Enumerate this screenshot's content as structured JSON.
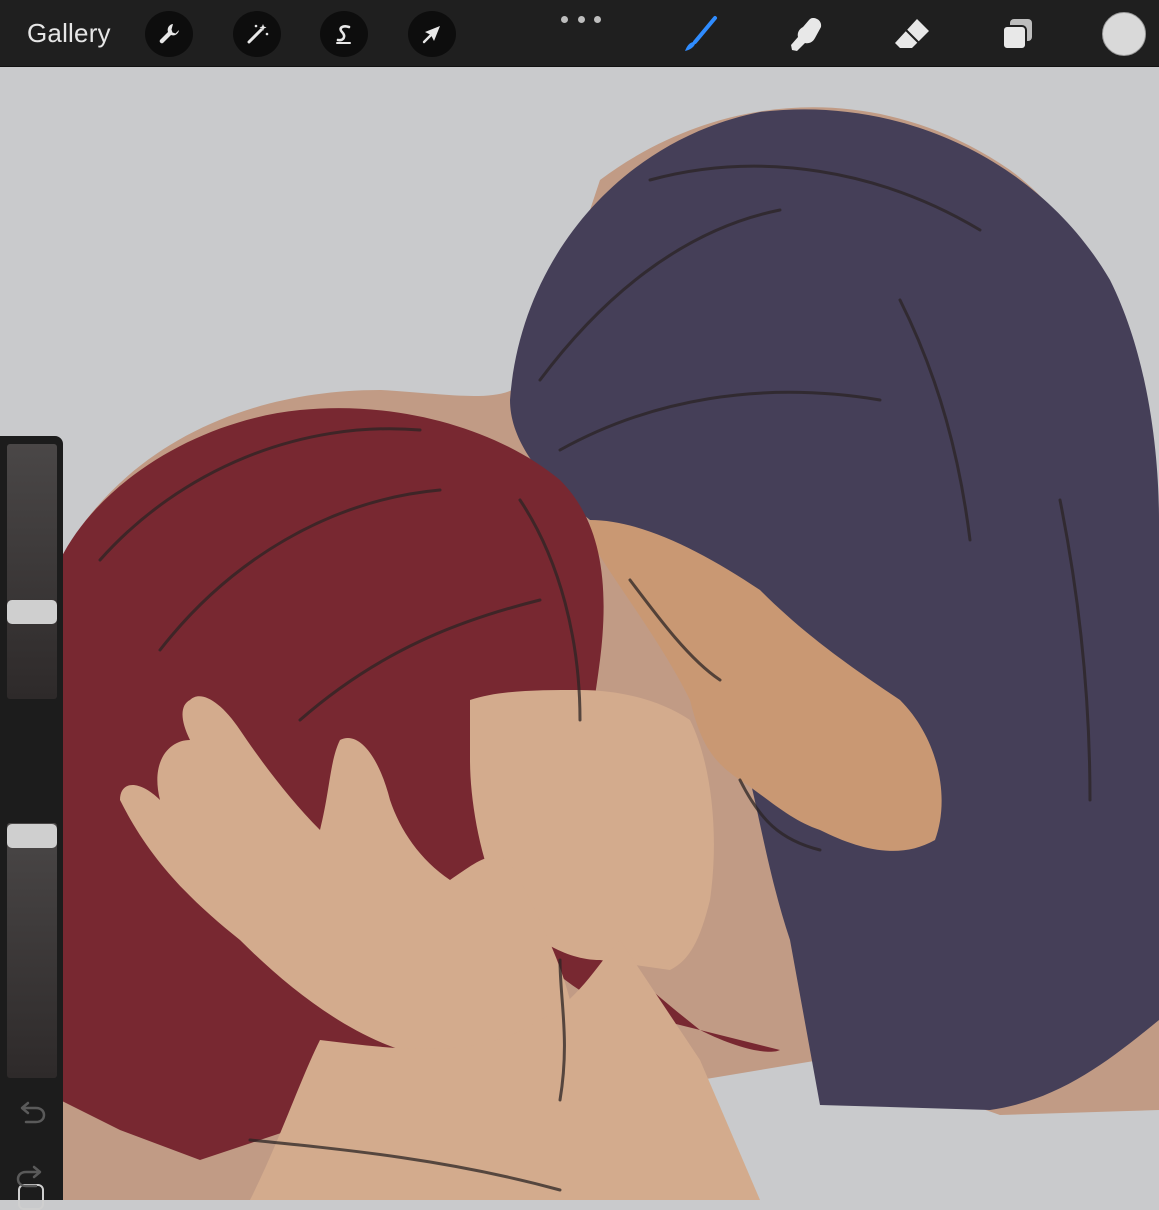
{
  "toolbar": {
    "gallery_label": "Gallery",
    "left_tools": [
      {
        "name": "actions",
        "icon": "wrench-icon"
      },
      {
        "name": "adjustments",
        "icon": "magic-wand-icon"
      },
      {
        "name": "selection",
        "icon": "selection-s-icon"
      },
      {
        "name": "transform",
        "icon": "arrow-cursor-icon"
      }
    ],
    "more_icon": "ellipsis-icon",
    "right_tools": [
      {
        "name": "brush",
        "icon": "brush-icon",
        "active": true,
        "color": "#2f8cff"
      },
      {
        "name": "smudge",
        "icon": "smudge-finger-icon",
        "active": false
      },
      {
        "name": "eraser",
        "icon": "eraser-icon",
        "active": false
      },
      {
        "name": "layers",
        "icon": "layers-icon",
        "active": false
      }
    ],
    "current_color": "#d9d9d9"
  },
  "sidebar": {
    "brush_size_level": 0.37,
    "opacity_level": 0.06,
    "modify_icon": "square-icon",
    "undo_icon": "undo-icon",
    "redo_icon": "redo-icon"
  },
  "canvas": {
    "background": "#c9cacc",
    "artwork": "digital-painting"
  }
}
